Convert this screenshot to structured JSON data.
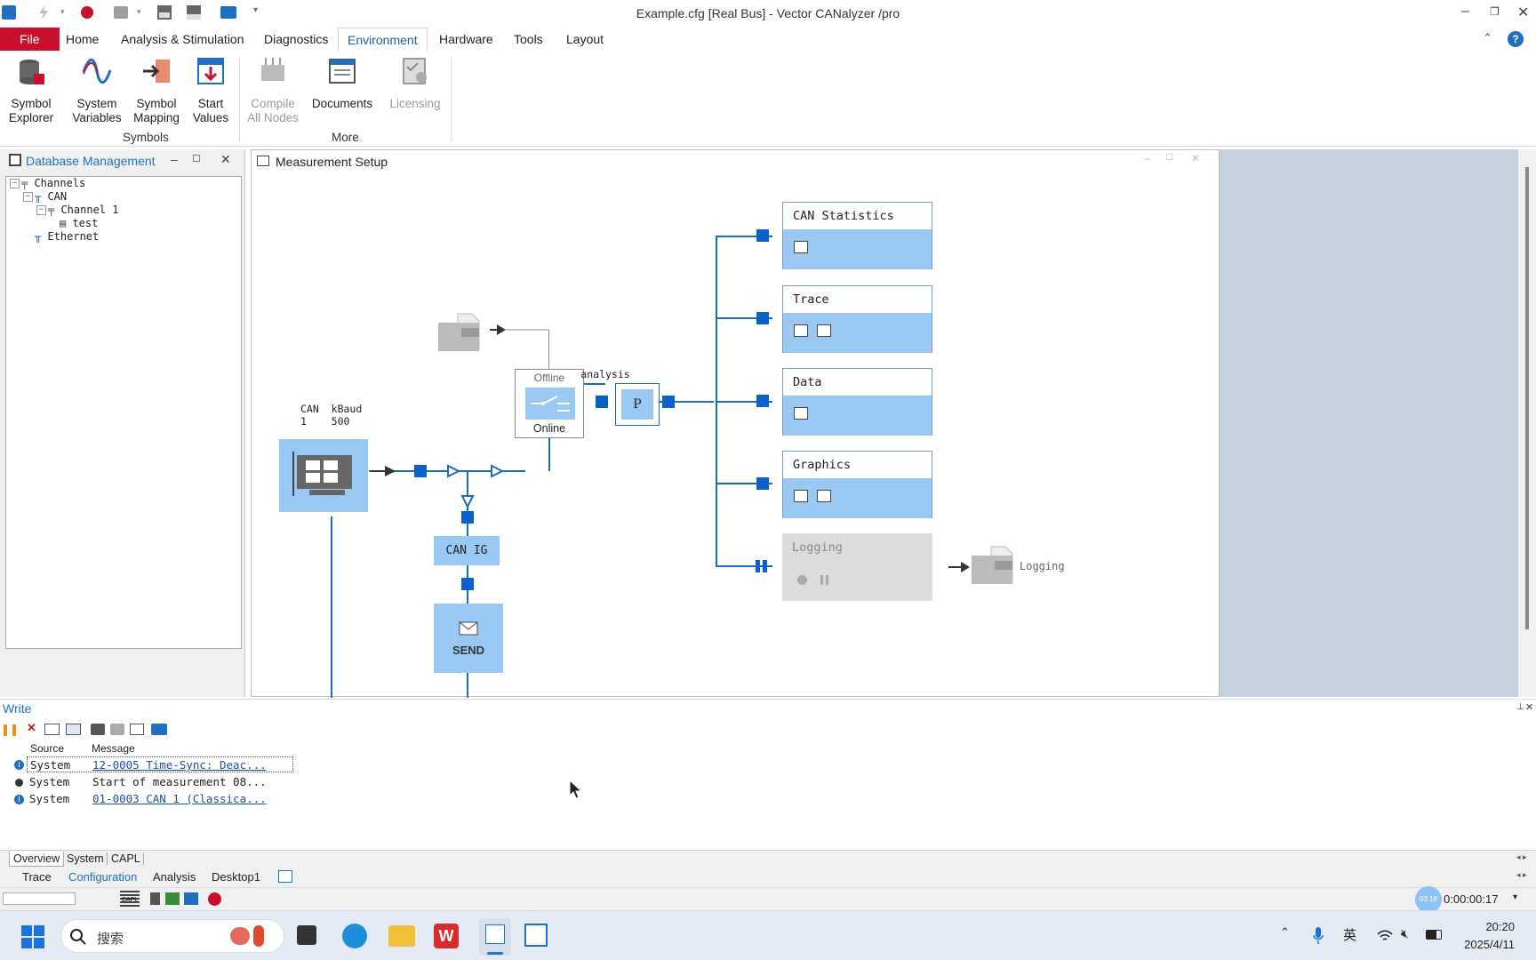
{
  "window": {
    "title": "Example.cfg [Real Bus] - Vector CANalyzer /pro"
  },
  "menu": {
    "file": "File",
    "items": [
      "Home",
      "Analysis & Stimulation",
      "Diagnostics",
      "Environment",
      "Hardware",
      "Tools",
      "Layout"
    ],
    "active": "Environment"
  },
  "ribbon": {
    "symbol_explorer": "Symbol\nExplorer",
    "system_variables": "System\nVariables",
    "symbol_mapping": "Symbol\nMapping",
    "start_values": "Start\nValues",
    "compile_all_nodes": "Compile\nAll Nodes",
    "documents": "Documents",
    "licensing": "Licensing",
    "group_symbols": "Symbols",
    "group_more": "More"
  },
  "db_panel": {
    "title": "Database Management",
    "tree": {
      "channels": "Channels",
      "can": "CAN",
      "channel1": "Channel 1",
      "test": "test",
      "ethernet": "Ethernet"
    }
  },
  "measurement": {
    "title": "Measurement Setup",
    "can_label": "CAN",
    "can_channel": "1",
    "kbaud_label": "kBaud",
    "kbaud_value": "500",
    "offline": "Offline",
    "online": "Online",
    "analysis": "analysis",
    "p_block": "P",
    "can_ig": "CAN IG",
    "send": "SEND",
    "blocks": {
      "can_statistics": "CAN Statistics",
      "trace": "Trace",
      "data": "Data",
      "graphics": "Graphics",
      "logging": "Logging"
    },
    "logging_file": "Logging"
  },
  "write": {
    "title": "Write",
    "col_source": "Source",
    "col_message": "Message",
    "rows": [
      {
        "source": "System",
        "message": "12-0005 Time-Sync: Deac..."
      },
      {
        "source": "System",
        "message": "Start of measurement 08..."
      },
      {
        "source": "System",
        "message": "01-0003 CAN 1 (Classica..."
      }
    ],
    "tabs": [
      "Overview",
      "System",
      "CAPL"
    ]
  },
  "desktops": {
    "tabs": [
      "Trace",
      "Configuration",
      "Analysis",
      "Desktop1"
    ],
    "active": "Configuration"
  },
  "status": {
    "clock": "0:00:00:17",
    "capl": "CAPL",
    "timer_badge": "03:18"
  },
  "taskbar": {
    "search_placeholder": "搜索",
    "ime": "英",
    "time": "20:20",
    "date": "2025/4/11"
  },
  "colors": {
    "accent": "#1a5fa8",
    "file_tab": "#c8102e",
    "block_fill": "#99c8f3",
    "connector": "#0a62c9"
  }
}
